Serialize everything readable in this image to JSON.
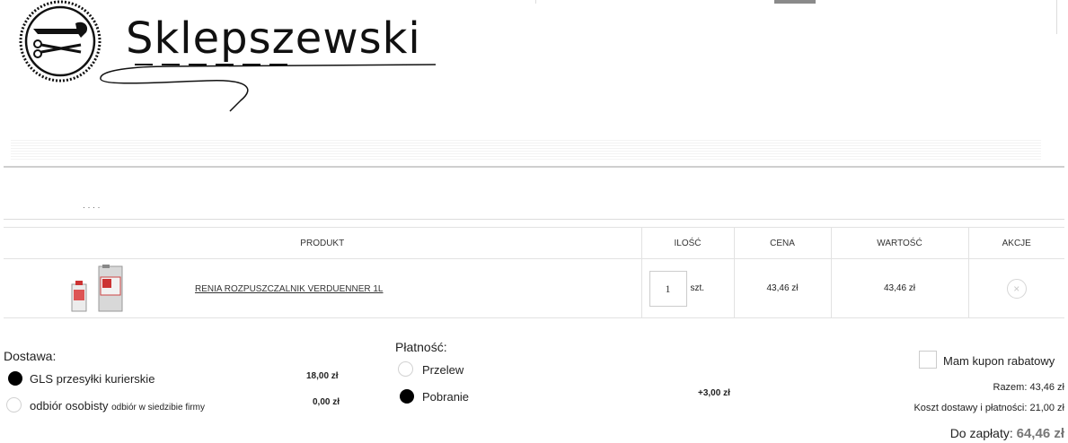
{
  "brand": {
    "name": "Sklepszewski"
  },
  "breadcrumb": {
    "text": "· ·   · ·"
  },
  "table": {
    "headers": {
      "product": "PRODUKT",
      "qty": "ILOŚĆ",
      "price": "CENA",
      "value": "WARTOŚĆ",
      "actions": "AKCJE"
    },
    "rows": [
      {
        "name": "RENIA ROZPUSZCZALNIK VERDUENNER 1L",
        "qty": "1",
        "unit": "szt.",
        "price": "43,46 zł",
        "value": "43,46 zł",
        "remove_icon": "close-icon",
        "remove_glyph": "×"
      }
    ]
  },
  "delivery": {
    "title": "Dostawa:",
    "options": [
      {
        "label": "GLS przesyłki kurierskie",
        "sub": "",
        "price": "18,00 zł",
        "selected": true
      },
      {
        "label": "odbiór osobisty",
        "sub": "odbiór w siedzibie firmy",
        "price": "0,00 zł",
        "selected": false
      }
    ]
  },
  "payment": {
    "title": "Płatność:",
    "options": [
      {
        "label": "Przelew",
        "price": "",
        "selected": false
      },
      {
        "label": "Pobranie",
        "price": "+3,00 zł",
        "selected": true
      }
    ]
  },
  "summary": {
    "coupon_label": "Mam kupon rabatowy",
    "subtotal_label": "Razem:",
    "subtotal": "43,46 zł",
    "shipping_label": "Koszt dostawy i płatności:",
    "shipping": "21,00 zł",
    "total_label": "Do zapłaty:",
    "total": "64,46 zł"
  }
}
